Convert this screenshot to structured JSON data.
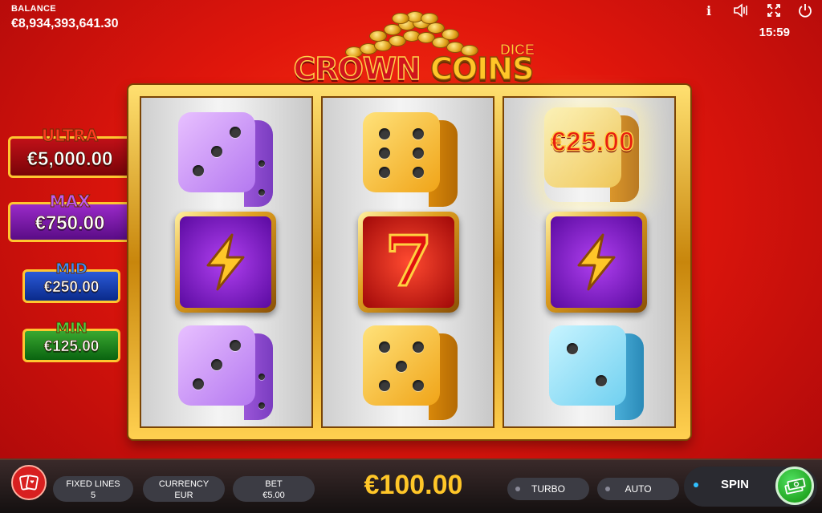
{
  "balance": {
    "label": "BALANCE",
    "value": "€8,934,393,641.30"
  },
  "top_icons": [
    "info-icon",
    "sound-icon",
    "fullscreen-icon",
    "power-icon"
  ],
  "info_glyph": "i",
  "clock": "15:59",
  "logo": {
    "word1": "CROWN",
    "word2": "COINS",
    "badge": "DICE"
  },
  "jackpots": [
    {
      "title": "ULTRA",
      "value": "€5,000.00",
      "color": "#c01018"
    },
    {
      "title": "MAX",
      "value": "€750.00",
      "color": "#9a2ac8"
    },
    {
      "title": "MID",
      "value": "€250.00",
      "color": "#2a5ad8"
    },
    {
      "title": "MIN",
      "value": "€125.00",
      "color": "#3aa830"
    }
  ],
  "reels": [
    [
      "purple-dice-3",
      "lightning-bolt",
      "purple-dice-3"
    ],
    [
      "gold-dice-6",
      "red-seven",
      "gold-dice-5"
    ],
    [
      "gold-dice-coin",
      "lightning-bolt",
      "cyan-dice-2"
    ]
  ],
  "reel_win": "€25.00",
  "seven_glyph": "7",
  "bottom": {
    "fixed_lines_label": "FIXED LINES",
    "fixed_lines_value": "5",
    "currency_label": "CURRENCY",
    "currency_value": "EUR",
    "bet_label": "BET",
    "bet_value": "€5.00",
    "total_bet": "€100.00",
    "turbo": "TURBO",
    "auto": "AUTO",
    "spin": "SPIN"
  },
  "colors": {
    "accent_gold": "#ffc628",
    "background_red": "#e0160c",
    "spin_green": "#10900a"
  }
}
